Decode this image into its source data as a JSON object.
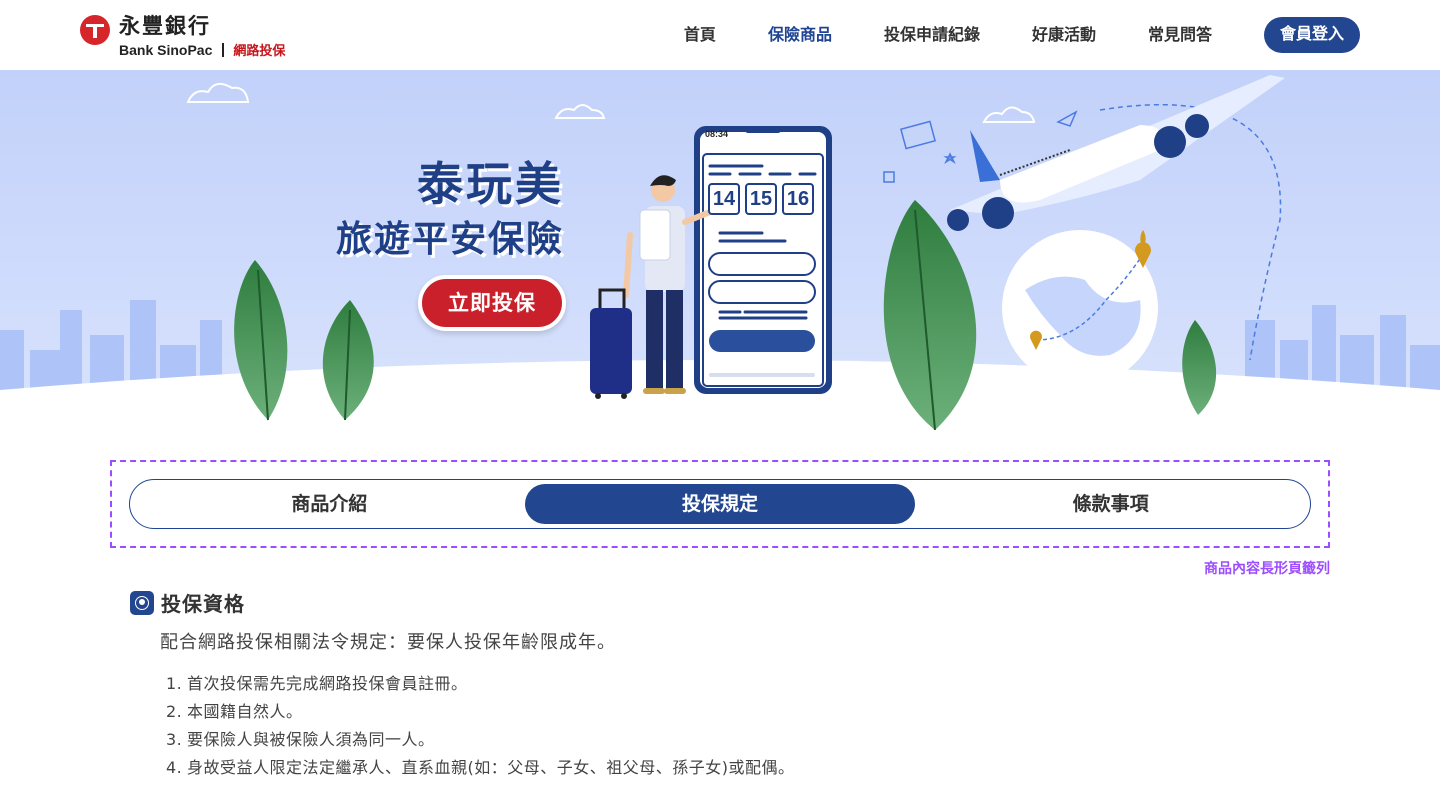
{
  "brand": {
    "name_cn": "永豐銀行",
    "name_en": "Bank SinoPac",
    "sub": "網路投保",
    "color": "#d7252c"
  },
  "nav": {
    "items": [
      {
        "label": "首頁"
      },
      {
        "label": "保險商品",
        "active": true
      },
      {
        "label": "投保申請紀錄"
      },
      {
        "label": "好康活動"
      },
      {
        "label": "常見問答"
      }
    ],
    "login_label": "會員登入"
  },
  "banner": {
    "title_line1": "泰玩美",
    "title_line2": "旅遊平安保險",
    "cta_label": "立即投保",
    "phone_time": "08:34",
    "phone_dates": [
      "14",
      "15",
      "16"
    ]
  },
  "tabs": {
    "items": [
      {
        "label": "商品介紹"
      },
      {
        "label": "投保規定",
        "active": true
      },
      {
        "label": "條款事項"
      }
    ],
    "annotation": "商品內容長形頁籤列"
  },
  "content": {
    "section_title": "投保資格",
    "section_icon": "user-circle-icon",
    "intro": "配合網路投保相關法令規定：要保人投保年齡限成年。",
    "rules": [
      {
        "num": "1.",
        "text": "首次投保需先完成網路投保會員註冊。"
      },
      {
        "num": "2.",
        "text": "本國籍自然人。"
      },
      {
        "num": "3.",
        "text": "要保險人與被保險人須為同一人。"
      },
      {
        "num": "4.",
        "text": "身故受益人限定法定繼承人、直系血親(如：父母、子女、祖父母、孫子女)或配偶。"
      }
    ]
  },
  "colors": {
    "primary": "#22468f",
    "accent_red": "#c9202b",
    "annotation": "#9b4dff",
    "banner_bg": "#c9d6fb"
  }
}
